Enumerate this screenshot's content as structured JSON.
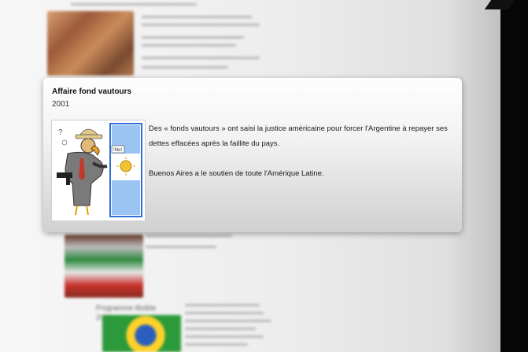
{
  "popup": {
    "title": "Affaire fond vautours",
    "year": "2001",
    "paragraphs": [
      "Des « fonds vautours » ont saisi la justice américaine pour forcer l'Argentine à repayer ses dettes effacées après la faillite du pays.",
      "Buenos Aires a le soutien de toute l'Amérique Latine."
    ],
    "image_alt": "cartoon-vulture-argentina"
  },
  "background": {
    "card3": {
      "title": "Programme illisible",
      "year": "2013"
    }
  }
}
